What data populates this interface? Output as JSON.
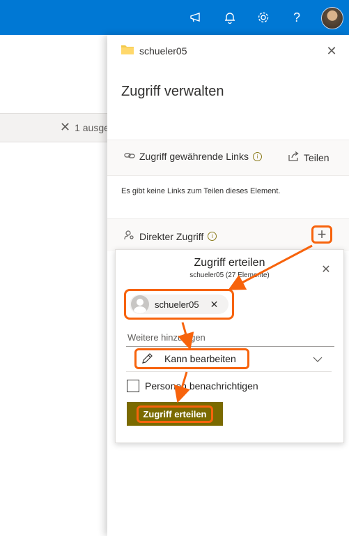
{
  "background": {
    "selection_text": "1 ausge"
  },
  "panel": {
    "item_name": "schueler05",
    "title": "Zugriff verwalten",
    "links_section_label": "Zugriff gewährende Links",
    "share_button_label": "Teilen",
    "no_links_text": "Es gibt keine Links zum Teilen dieses Element.",
    "direct_access_label": "Direkter Zugriff"
  },
  "dialog": {
    "title": "Zugriff erteilen",
    "subtitle": "schueler05 (27 Elemente)",
    "person_chip_name": "schueler05",
    "add_more_placeholder": "Weitere hinzufügen",
    "permission_label": "Kann bearbeiten",
    "notify_label": "Personen benachrichtigen",
    "grant_button_label": "Zugriff erteilen"
  },
  "colors": {
    "topbar": "#0078d4",
    "highlight": "#f7630c",
    "grant_button": "#7a6a00"
  },
  "icons": [
    "announcement-icon",
    "bell-icon",
    "gear-icon",
    "help-icon",
    "folder-icon",
    "link-icon",
    "share-icon",
    "person-key-icon",
    "plus-icon",
    "pencil-icon",
    "chevron-down-icon",
    "close-icon"
  ]
}
